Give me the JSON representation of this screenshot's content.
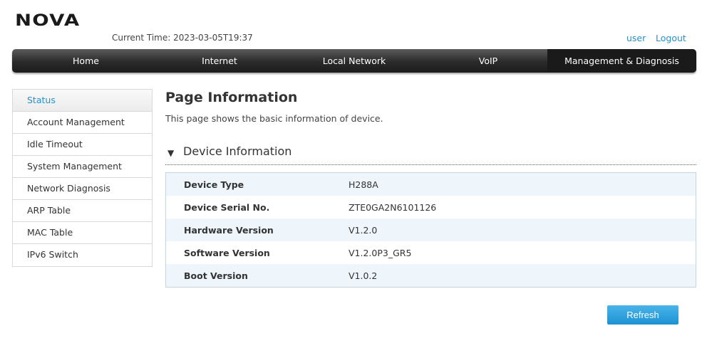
{
  "brand": {
    "logo_text": "NOVA"
  },
  "header": {
    "current_time_label": "Current Time: 2023-03-05T19:37",
    "user_link": "user",
    "logout_link": "Logout"
  },
  "topnav": {
    "tabs": [
      {
        "label": "Home",
        "active": false
      },
      {
        "label": "Internet",
        "active": false
      },
      {
        "label": "Local Network",
        "active": false
      },
      {
        "label": "VoIP",
        "active": false
      },
      {
        "label": "Management & Diagnosis",
        "active": true
      }
    ]
  },
  "sidebar": {
    "items": [
      {
        "label": "Status",
        "active": true
      },
      {
        "label": "Account Management",
        "active": false
      },
      {
        "label": "Idle Timeout",
        "active": false
      },
      {
        "label": "System Management",
        "active": false
      },
      {
        "label": "Network Diagnosis",
        "active": false
      },
      {
        "label": "ARP Table",
        "active": false
      },
      {
        "label": "MAC Table",
        "active": false
      },
      {
        "label": "IPv6 Switch",
        "active": false
      }
    ]
  },
  "main": {
    "title": "Page Information",
    "description": "This page shows the basic information of device.",
    "section": {
      "expand_icon": "triangle-down-icon",
      "title": "Device Information",
      "rows": [
        {
          "key": "Device Type",
          "value": "H288A"
        },
        {
          "key": "Device Serial No.",
          "value": "ZTE0GA2N6101126"
        },
        {
          "key": "Hardware Version",
          "value": "V1.2.0"
        },
        {
          "key": "Software Version",
          "value": "V1.2.0P3_GR5"
        },
        {
          "key": "Boot Version",
          "value": "V1.0.2"
        }
      ]
    },
    "refresh_label": "Refresh"
  },
  "colors": {
    "accent": "#2a8fc8",
    "nav_bg": "#2a2a2a",
    "button": "#1d92d2",
    "row_alt": "#eef6fc"
  }
}
